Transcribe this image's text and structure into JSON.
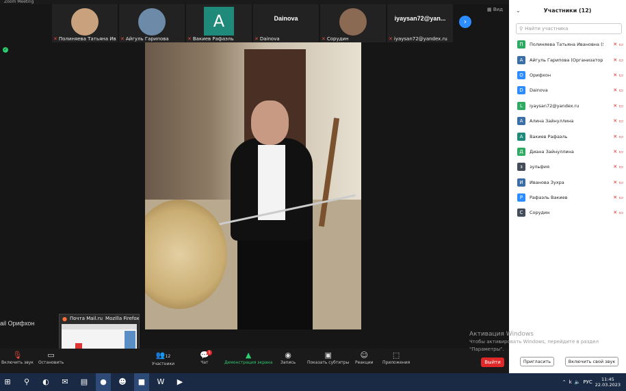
{
  "window": {
    "title": "Zoom Meeting"
  },
  "thumbnails": [
    {
      "name": "Полиняева Татьяна Ивано...",
      "type": "video"
    },
    {
      "name": "Айгуль Гарипова",
      "type": "video"
    },
    {
      "name": "Вакиев Рафаэль",
      "type": "avatar",
      "letter": "A"
    },
    {
      "name": "Dainova",
      "type": "namecard",
      "card": "Dainova"
    },
    {
      "name": "Сорудин",
      "type": "video"
    },
    {
      "name": "iyaysan72@yandex.ru",
      "type": "namecard",
      "card": "iyaysan72@yan..."
    }
  ],
  "view_label": "Вид",
  "self_label": "ail Орифхон",
  "preview": {
    "title": "Почта Mail.ru — Mozilla Firefox",
    "tab1": "Почта Mail.ru",
    "tab2": "Mozilla Firefox"
  },
  "toolbar": {
    "mute": "Включить звук",
    "stop": "Остановить",
    "participants": "Участники",
    "participants_count": "12",
    "chat": "Чат",
    "chat_badge": "1",
    "share": "Демонстрация экрана",
    "record": "Запись",
    "captions": "Показать субтитры",
    "reactions": "Реакции",
    "apps": "Приложения",
    "leave": "Выйти"
  },
  "panel": {
    "title": "Участники (12)",
    "search_placeholder": "Найти участника",
    "participants": [
      {
        "name": "Полиняева Татьяна Ивановна (Я)",
        "letter": "П",
        "color": "#2eaa63"
      },
      {
        "name": "Айгуль Гарипова (Организатор)",
        "letter": "A",
        "color": "#3a6ea5"
      },
      {
        "name": "Орифхон",
        "letter": "О",
        "color": "#2d8cff"
      },
      {
        "name": "Dainova",
        "letter": "D",
        "color": "#2d8cff"
      },
      {
        "name": "iyaysan72@yandex.ru",
        "letter": "L",
        "color": "#2eaa63"
      },
      {
        "name": "Алина Зайнуллина",
        "letter": "A",
        "color": "#3a6ea5"
      },
      {
        "name": "Вакиев Рафаэль",
        "letter": "A",
        "color": "#1f8a7a"
      },
      {
        "name": "Диана Зайнуллина",
        "letter": "Д",
        "color": "#2eaa63"
      },
      {
        "name": "зульфия",
        "letter": "з",
        "color": "#444c5a"
      },
      {
        "name": "Иванова Зухра",
        "letter": "И",
        "color": "#3a6ea5"
      },
      {
        "name": "Рафаэль Вакиев",
        "letter": "Р",
        "color": "#2d8cff"
      },
      {
        "name": "Сорудин",
        "letter": "С",
        "color": "#444c5a"
      }
    ],
    "invite": "Пригласить",
    "unmute_me": "Включить свой звук"
  },
  "watermark": {
    "line1": "Активация Windows",
    "line2": "Чтобы активировать Windows, перейдите в раздел",
    "line3": "\"Параметры\"."
  },
  "taskbar": {
    "lang": "РУС",
    "time": "11:45",
    "date": "22.03.2023"
  }
}
